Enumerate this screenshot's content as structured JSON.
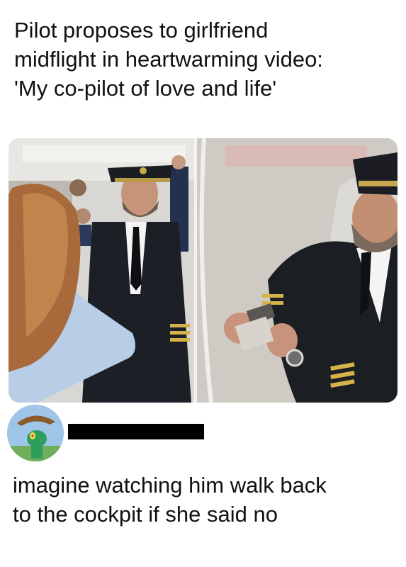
{
  "headline": {
    "lines": [
      "Pilot proposes to girlfriend",
      "midflight in heartwarming video:",
      "'My co-pilot of love and life'"
    ]
  },
  "comment": {
    "lines": [
      "imagine watching him walk back",
      "to the cockpit if she said no"
    ],
    "username_redacted": true
  }
}
